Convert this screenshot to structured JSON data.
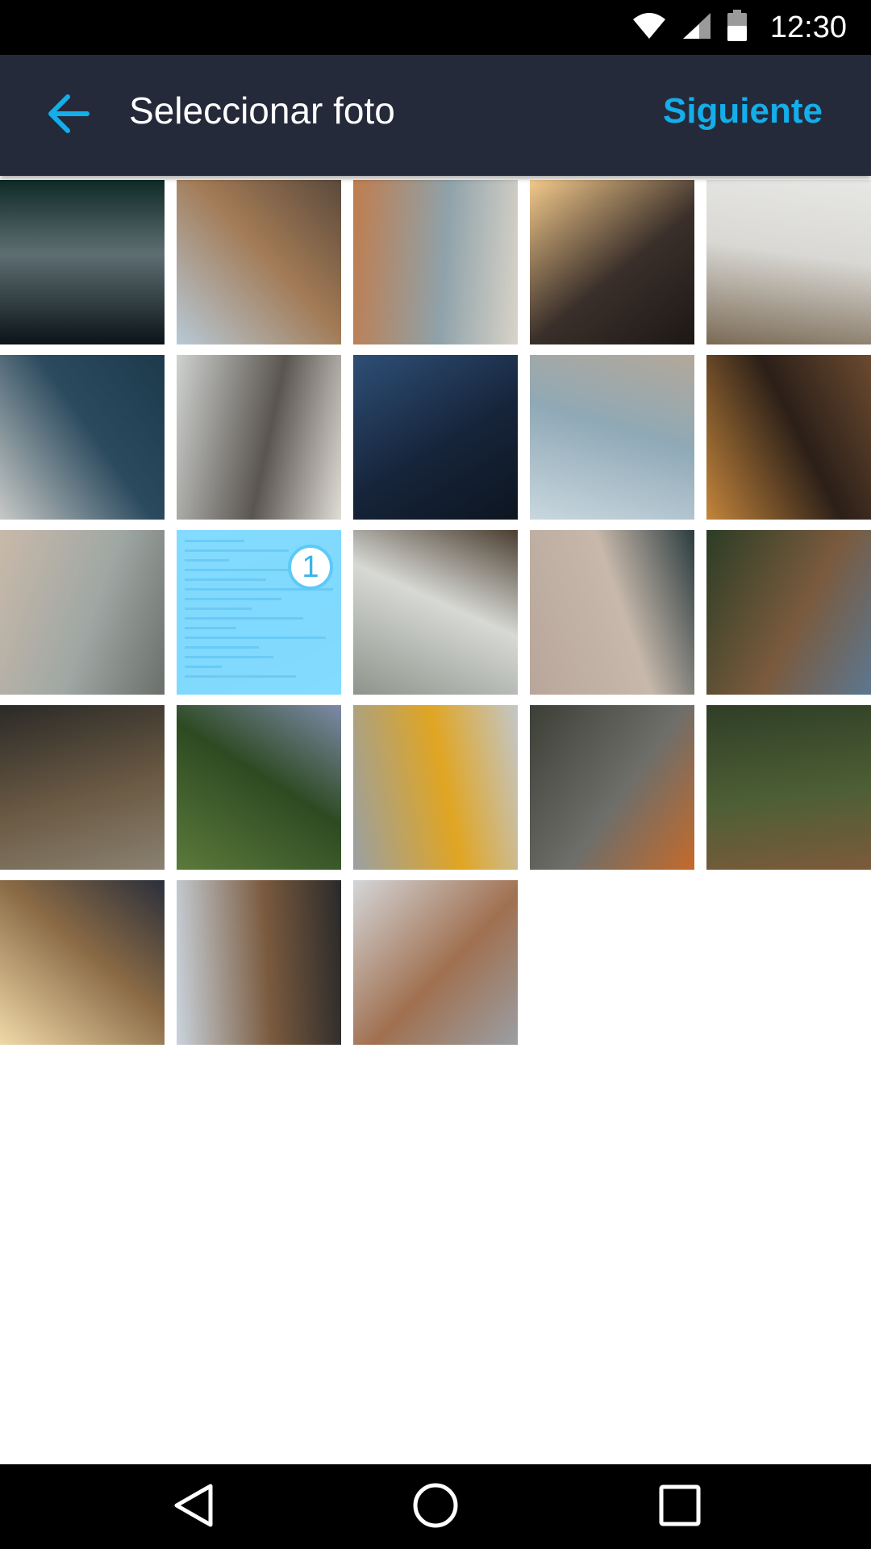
{
  "status_bar": {
    "time": "12:30",
    "icons": [
      "wifi-icon",
      "cell-signal-icon",
      "battery-icon"
    ]
  },
  "app_bar": {
    "title": "Seleccionar foto",
    "next_label": "Siguiente",
    "back_icon": "arrow-back-icon",
    "colors": {
      "background": "#252a3a",
      "accent": "#14aeea"
    }
  },
  "grid": {
    "photos": [
      {
        "name": "photo-ocean-wave",
        "colors": [
          "#0b1418",
          "#5e6e72",
          "#0f2a26"
        ],
        "selected": false
      },
      {
        "name": "photo-city-skyscrapers",
        "colors": [
          "#b7c9d6",
          "#a27a55",
          "#5b4a3c"
        ],
        "selected": false
      },
      {
        "name": "photo-dog-cafe",
        "colors": [
          "#c07d4e",
          "#8fa2aa",
          "#d8d3c8"
        ],
        "selected": false
      },
      {
        "name": "photo-couple-sunset",
        "colors": [
          "#f3c98b",
          "#3a2f2a",
          "#1d1815"
        ],
        "selected": false
      },
      {
        "name": "photo-man-walking-street",
        "colors": [
          "#7a6a55",
          "#d9d8d4",
          "#e7e7e5"
        ],
        "selected": false
      },
      {
        "name": "photo-man-drinking-coffee",
        "colors": [
          "#c7c9c6",
          "#2b4a5e",
          "#1d3a4c"
        ],
        "selected": false
      },
      {
        "name": "photo-woman-beach",
        "colors": [
          "#cfd2d0",
          "#5a5550",
          "#e0dcd6"
        ],
        "selected": false
      },
      {
        "name": "photo-lantern-night",
        "colors": [
          "#2e4f77",
          "#16243a",
          "#0d1520"
        ],
        "selected": false
      },
      {
        "name": "photo-surfer",
        "colors": [
          "#c9d7df",
          "#8fa9b6",
          "#b3a89a"
        ],
        "selected": false
      },
      {
        "name": "photo-curved-building",
        "colors": [
          "#c3853b",
          "#2b1f18",
          "#6b4a30"
        ],
        "selected": false
      },
      {
        "name": "photo-father-child",
        "colors": [
          "#c9b9a9",
          "#9fa7a4",
          "#6a6f6a"
        ],
        "selected": false
      },
      {
        "name": "photo-document-screenshot",
        "colors": [
          "#ffffff",
          "#eef4f8",
          "#ffffff"
        ],
        "selected": true,
        "badge": "1"
      },
      {
        "name": "photo-rocky-coast",
        "colors": [
          "#8e948c",
          "#d7d9d5",
          "#4b3e30"
        ],
        "selected": false
      },
      {
        "name": "photo-woman-sunglasses",
        "colors": [
          "#b8a69a",
          "#c7b8ab",
          "#2b3c3f"
        ],
        "selected": false
      },
      {
        "name": "photo-woman-hat-forest",
        "colors": [
          "#2b3d25",
          "#7a5a3d",
          "#5c7790"
        ],
        "selected": false
      },
      {
        "name": "photo-subway-station",
        "colors": [
          "#2b2a27",
          "#6b5a44",
          "#8a8170"
        ],
        "selected": false
      },
      {
        "name": "photo-person-laptop-garden",
        "colors": [
          "#5b7a3a",
          "#2d4a22",
          "#7d8aa8"
        ],
        "selected": false
      },
      {
        "name": "photo-yellow-raincoat",
        "colors": [
          "#9aa0a3",
          "#e0a522",
          "#c3c7c9"
        ],
        "selected": false
      },
      {
        "name": "photo-road-aerial",
        "colors": [
          "#3c3f36",
          "#6e6e6a",
          "#c56a2a"
        ],
        "selected": false
      },
      {
        "name": "photo-forest-path",
        "colors": [
          "#2f3e26",
          "#4d5f35",
          "#7d5a3b"
        ],
        "selected": false
      },
      {
        "name": "photo-man-sunlight",
        "colors": [
          "#f0d9a8",
          "#8a6a45",
          "#2a2f3a"
        ],
        "selected": false
      },
      {
        "name": "photo-mountain-landscape",
        "colors": [
          "#c9d3dc",
          "#7a5a3e",
          "#2a2a2a"
        ],
        "selected": false
      },
      {
        "name": "photo-wet-road-city",
        "colors": [
          "#d4d6d8",
          "#a07050",
          "#9a9fa4"
        ],
        "selected": false
      }
    ]
  },
  "nav_bar": {
    "icons": [
      "back-triangle-icon",
      "home-circle-icon",
      "recents-square-icon"
    ]
  }
}
